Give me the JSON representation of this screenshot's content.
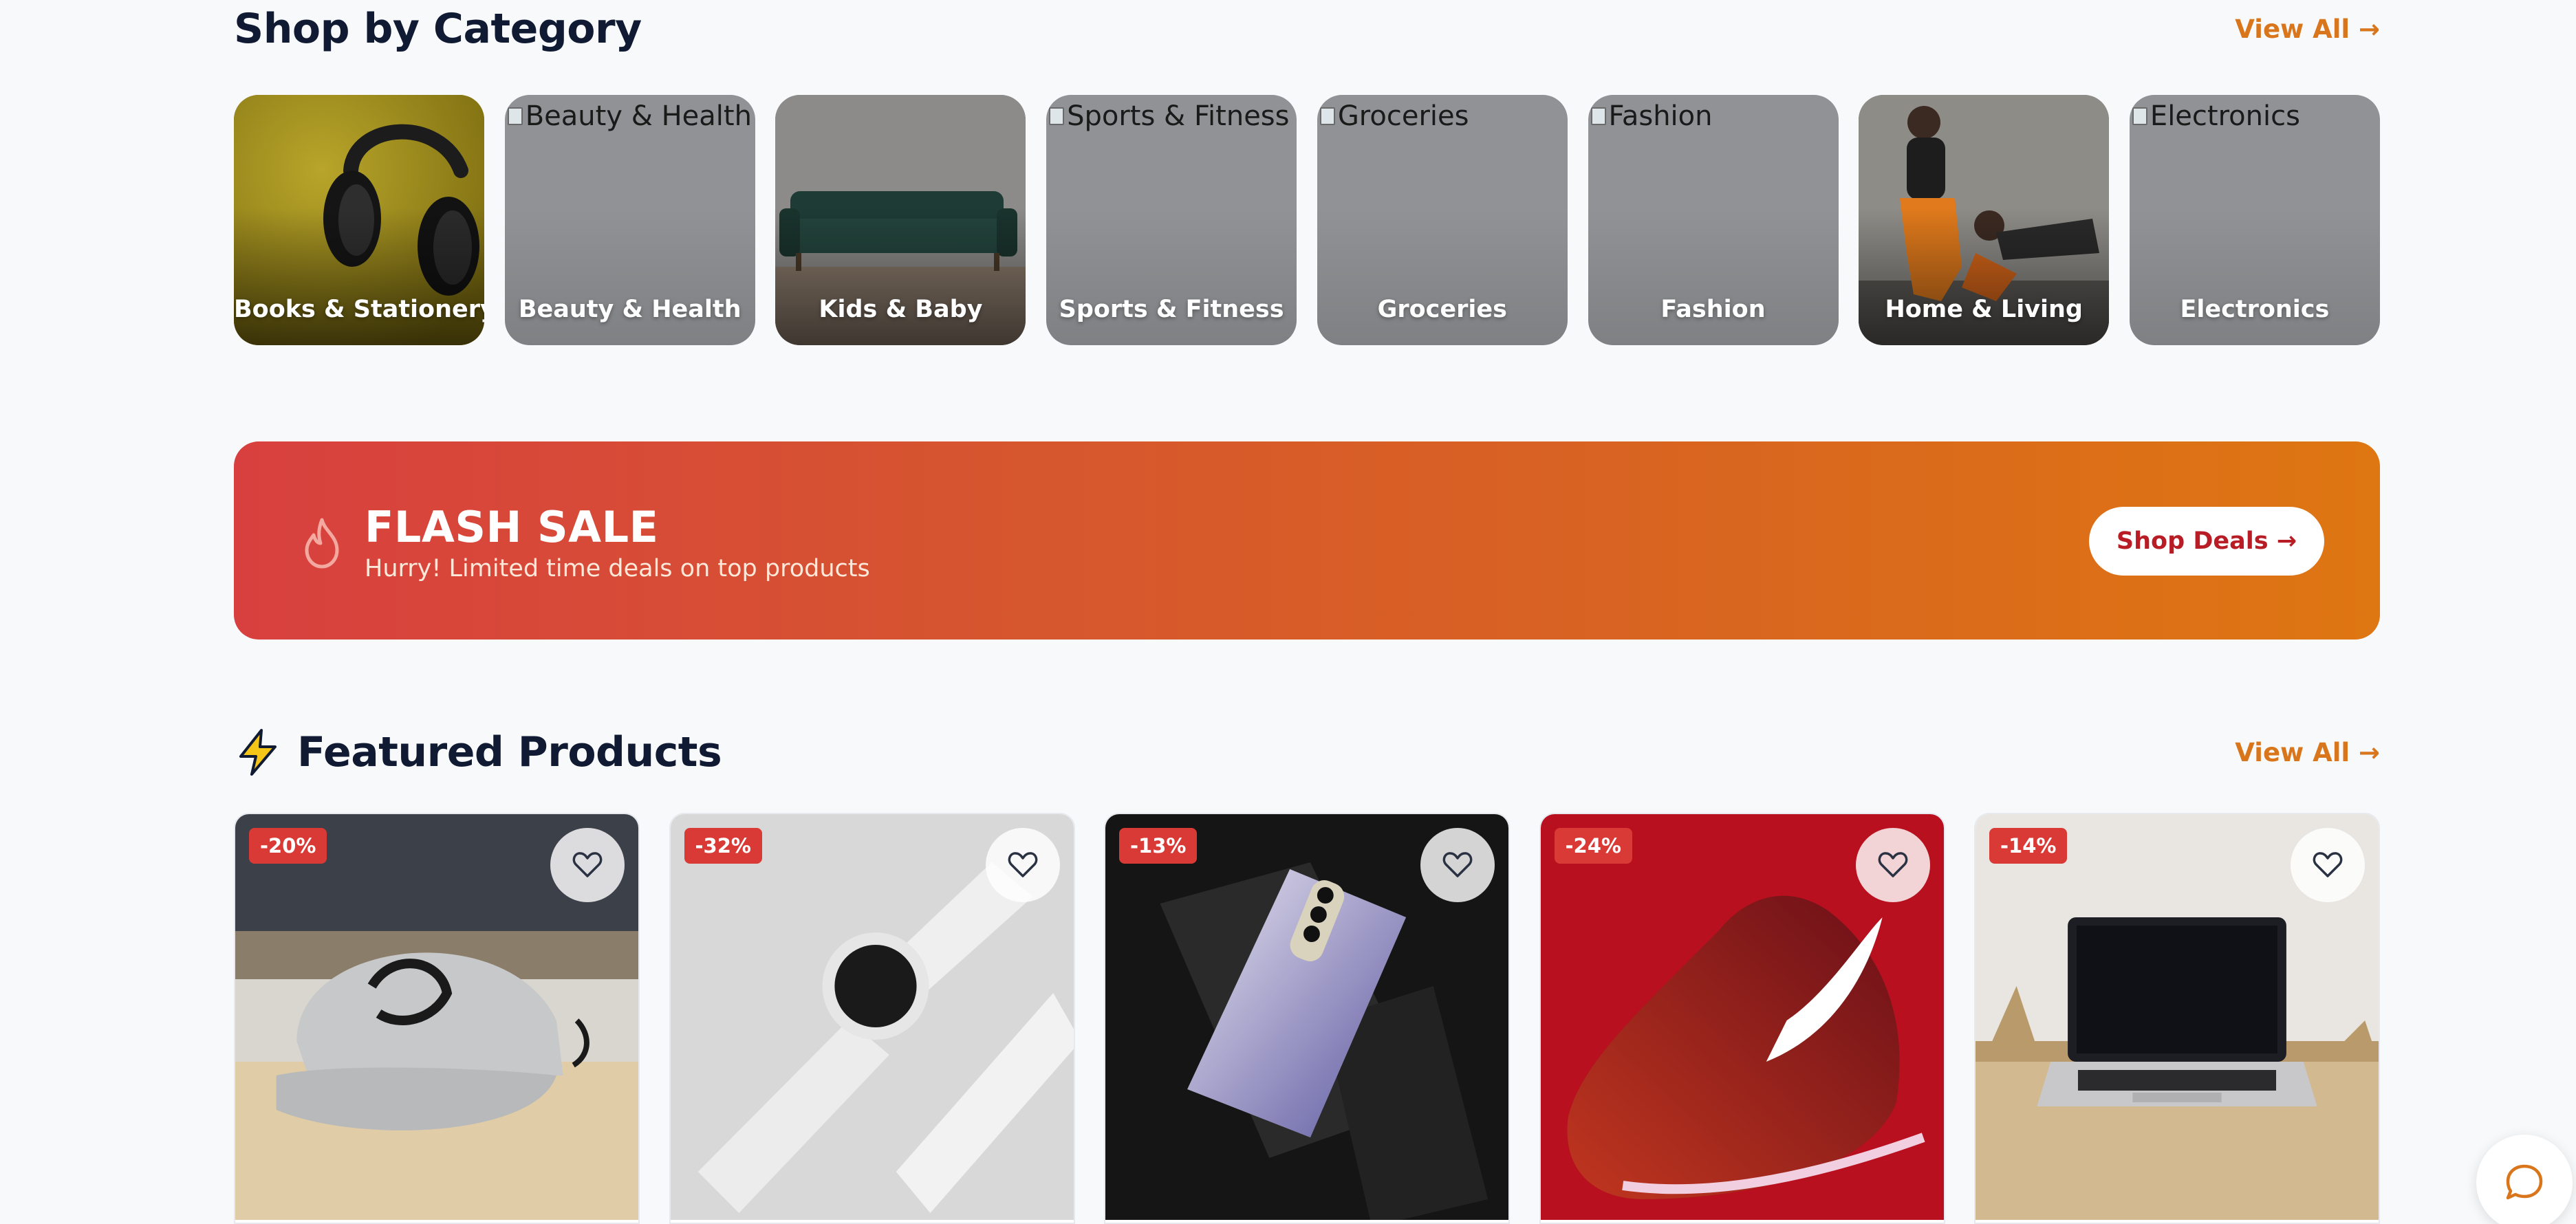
{
  "category_section": {
    "title": "Shop by Category",
    "view_all": "View All →",
    "tiles": [
      {
        "label": "Books & Stationery",
        "alt": ""
      },
      {
        "label": "Beauty & Health",
        "alt": "Beauty & Health"
      },
      {
        "label": "Kids & Baby",
        "alt": ""
      },
      {
        "label": "Sports & Fitness",
        "alt": "Sports & Fitness"
      },
      {
        "label": "Groceries",
        "alt": "Groceries"
      },
      {
        "label": "Fashion",
        "alt": "Fashion"
      },
      {
        "label": "Home & Living",
        "alt": ""
      },
      {
        "label": "Electronics",
        "alt": "Electronics"
      }
    ]
  },
  "flash_sale": {
    "icon": "flame-icon",
    "title": "FLASH SALE",
    "subtitle": "Hurry! Limited time deals on top products",
    "button": "Shop Deals →"
  },
  "featured_section": {
    "icon": "lightning-icon",
    "title": "Featured Products",
    "view_all": "View All →",
    "products": [
      {
        "discount": "-20%",
        "image": "baseball-cap"
      },
      {
        "discount": "-32%",
        "image": "smartwatch"
      },
      {
        "discount": "-13%",
        "image": "smartphone"
      },
      {
        "discount": "-24%",
        "image": "red-sneaker"
      },
      {
        "discount": "-14%",
        "image": "laptop"
      }
    ]
  },
  "chat": {
    "icon": "chat-bubble-icon"
  },
  "colors": {
    "accent": "#d9751a",
    "heading": "#101a33",
    "badge": "#d93a36",
    "banner_start": "#d8403f",
    "banner_end": "#de7612"
  }
}
